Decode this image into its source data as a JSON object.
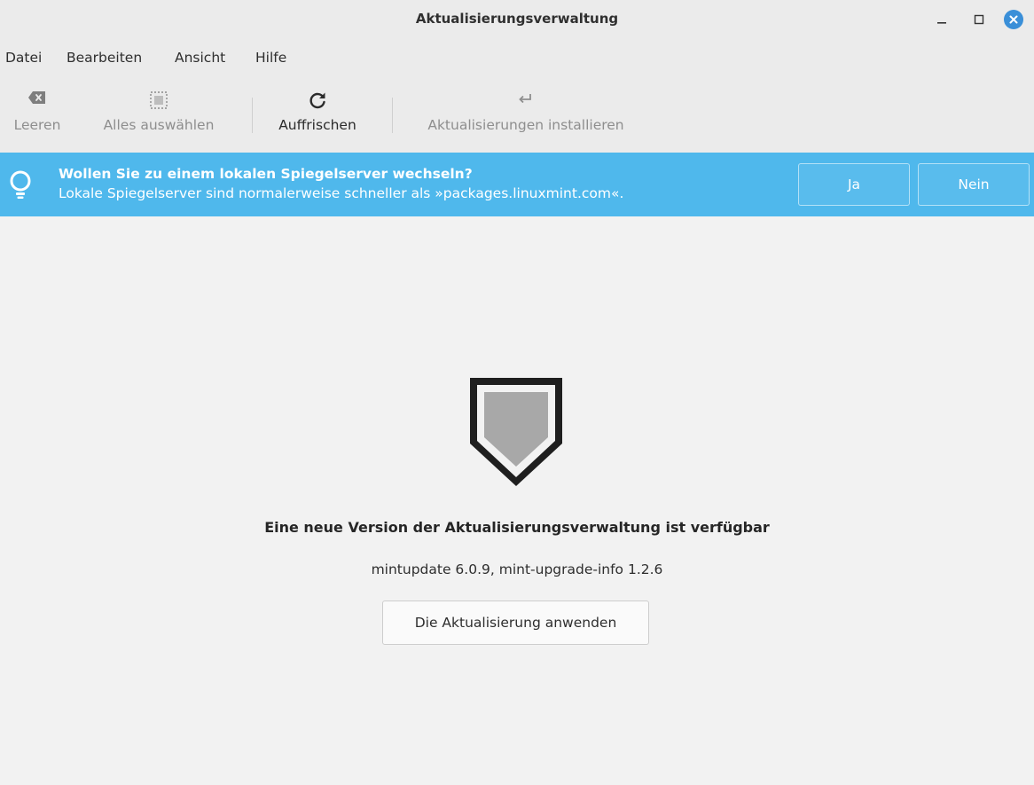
{
  "window": {
    "title": "Aktualisierungsverwaltung"
  },
  "menu": {
    "items": [
      "Datei",
      "Bearbeiten",
      "Ansicht",
      "Hilfe"
    ]
  },
  "toolbar": {
    "clear_label": "Leeren",
    "select_all_label": "Alles auswählen",
    "refresh_label": "Auffrischen",
    "install_label": "Aktualisierungen installieren"
  },
  "infobar": {
    "title": "Wollen Sie zu einem lokalen Spiegelserver wechseln?",
    "text": "Lokale Spiegelserver sind normalerweise schneller als »packages.linuxmint.com«.",
    "yes_label": "Ja",
    "no_label": "Nein",
    "color": "#4fb8ec"
  },
  "main": {
    "headline": "Eine neue Version der Aktualisierungsverwaltung ist verfügbar",
    "versions": "mintupdate 6.0.9, mint-upgrade-info 1.2.6",
    "apply_label": "Die Aktualisierung anwenden"
  },
  "colors": {
    "close_button": "#3a8fd8",
    "background": "#f2f2f2",
    "chrome": "#ebebeb"
  }
}
